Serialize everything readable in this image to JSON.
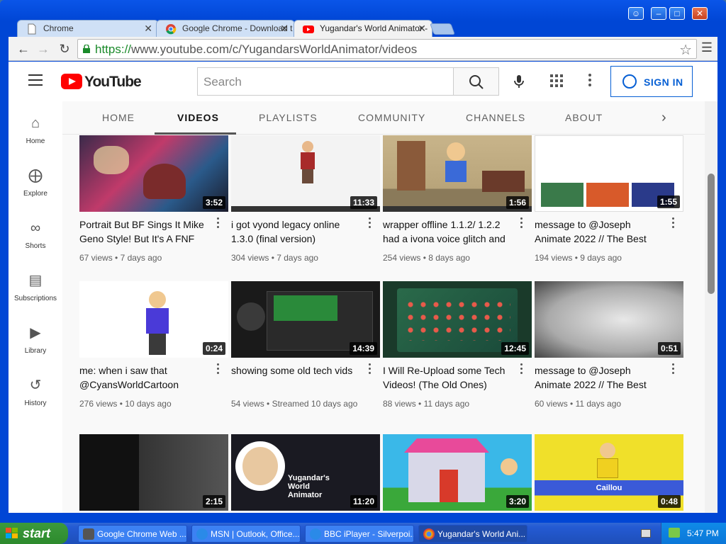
{
  "browser": {
    "tabs": [
      {
        "title": "Chrome",
        "active": false
      },
      {
        "title": "Google Chrome - Download t",
        "active": false
      },
      {
        "title": "Yugandar's World Animator -",
        "active": true
      }
    ],
    "url_scheme": "https://",
    "url_rest": "www.youtube.com/c/YugandarsWorldAnimator/videos"
  },
  "youtube": {
    "logo_text": "YouTube",
    "search_placeholder": "Search",
    "sign_in_label": "SIGN IN",
    "sidebar": [
      {
        "label": "Home",
        "icon": "home-icon"
      },
      {
        "label": "Explore",
        "icon": "compass-icon"
      },
      {
        "label": "Shorts",
        "icon": "shorts-icon"
      },
      {
        "label": "Subscriptions",
        "icon": "subscriptions-icon"
      },
      {
        "label": "Library",
        "icon": "library-icon"
      },
      {
        "label": "History",
        "icon": "history-icon"
      }
    ],
    "channel_tabs": [
      "HOME",
      "VIDEOS",
      "PLAYLISTS",
      "COMMUNITY",
      "CHANNELS",
      "ABOUT"
    ],
    "active_tab": "VIDEOS",
    "videos": [
      {
        "title": "Portrait But BF Sings It Mike Geno Style! But It's A FNF",
        "views": "67 views",
        "age": "7 days ago",
        "duration": "3:52"
      },
      {
        "title": "i got vyond legacy online 1.3.0 (final version)",
        "views": "304 views",
        "age": "7 days ago",
        "duration": "11:33"
      },
      {
        "title": "wrapper offline 1.1.2/ 1.2.2 had a ivona voice glitch and",
        "views": "254 views",
        "age": "8 days ago",
        "duration": "1:56"
      },
      {
        "title": "message to @Joseph Animate 2022 // The Best",
        "views": "194 views",
        "age": "9 days ago",
        "duration": "1:55"
      },
      {
        "title": "me: when i saw that @CyansWorldCartoon",
        "views": "276 views",
        "age": "10 days ago",
        "duration": "0:24"
      },
      {
        "title": "showing some old tech vids",
        "views": "54 views",
        "age": "Streamed 10 days ago",
        "duration": "14:39"
      },
      {
        "title": "I Will Re-Upload some Tech Videos! (The Old Ones)",
        "views": "88 views",
        "age": "11 days ago",
        "duration": "12:45"
      },
      {
        "title": "message to @Joseph Animate 2022 // The Best",
        "views": "60 views",
        "age": "11 days ago",
        "duration": "0:51"
      },
      {
        "title": "",
        "views": "",
        "age": "",
        "duration": "2:15"
      },
      {
        "title": "",
        "views": "",
        "age": "",
        "duration": "11:20"
      },
      {
        "title": "",
        "views": "",
        "age": "",
        "duration": "3:20"
      },
      {
        "title": "",
        "views": "",
        "age": "",
        "duration": "0:48"
      }
    ],
    "thumb_text": {
      "channel_card": "Yugandar's World Animator",
      "caillou": "Caillou"
    }
  },
  "taskbar": {
    "start_label": "start",
    "tasks": [
      {
        "title": "Google Chrome Web ...",
        "active": false
      },
      {
        "title": "MSN | Outlook, Office...",
        "active": false
      },
      {
        "title": "BBC iPlayer - Silverpoi...",
        "active": false
      },
      {
        "title": "Yugandar's World Ani...",
        "active": true
      }
    ],
    "clock": "5:47 PM"
  },
  "colors": {
    "youtube_red": "#ff0000",
    "signin_blue": "#065fd4",
    "xp_blue": "#0046d5",
    "start_green": "#2d8a2d"
  }
}
